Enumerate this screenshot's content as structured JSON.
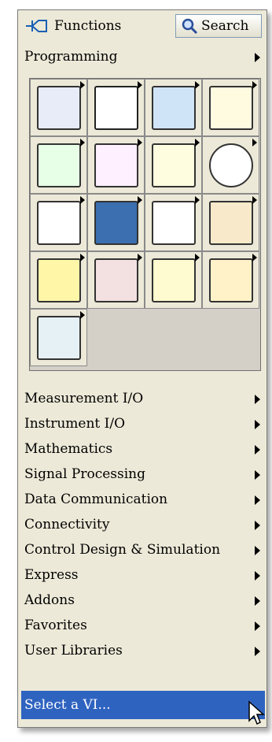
{
  "header": {
    "functions_label": "Functions",
    "search_label": "Search",
    "functions_icon": "pin-icon",
    "search_icon": "magnifier-icon"
  },
  "programming_label": "Programming",
  "palette_tiles": [
    {
      "icon": "structures-icon"
    },
    {
      "icon": "array-icon"
    },
    {
      "icon": "cluster-icon"
    },
    {
      "icon": "numeric-icon"
    },
    {
      "icon": "boolean-icon"
    },
    {
      "icon": "string-icon"
    },
    {
      "icon": "comparison-icon"
    },
    {
      "icon": "timing-icon"
    },
    {
      "icon": "dialog-ui-icon"
    },
    {
      "icon": "file-io-icon"
    },
    {
      "icon": "waveform-icon"
    },
    {
      "icon": "app-control-icon"
    },
    {
      "icon": "sync-icon"
    },
    {
      "icon": "graphics-sound-icon"
    },
    {
      "icon": "report-generation-icon"
    },
    {
      "icon": "state-diagram-icon"
    },
    {
      "icon": "measurement-icon"
    }
  ],
  "menu_items": [
    {
      "label": "Measurement I/O",
      "has_submenu": true
    },
    {
      "label": "Instrument I/O",
      "has_submenu": true
    },
    {
      "label": "Mathematics",
      "has_submenu": true
    },
    {
      "label": "Signal Processing",
      "has_submenu": true
    },
    {
      "label": "Data Communication",
      "has_submenu": true
    },
    {
      "label": "Connectivity",
      "has_submenu": true
    },
    {
      "label": "Control Design & Simulation",
      "has_submenu": true
    },
    {
      "label": "Express",
      "has_submenu": true
    },
    {
      "label": "Addons",
      "has_submenu": true
    },
    {
      "label": "Favorites",
      "has_submenu": true
    },
    {
      "label": "User Libraries",
      "has_submenu": true
    }
  ],
  "selected_item": "Select a VI...",
  "colors": {
    "selection": "#2f63c0",
    "panel": "#ece9d8"
  }
}
